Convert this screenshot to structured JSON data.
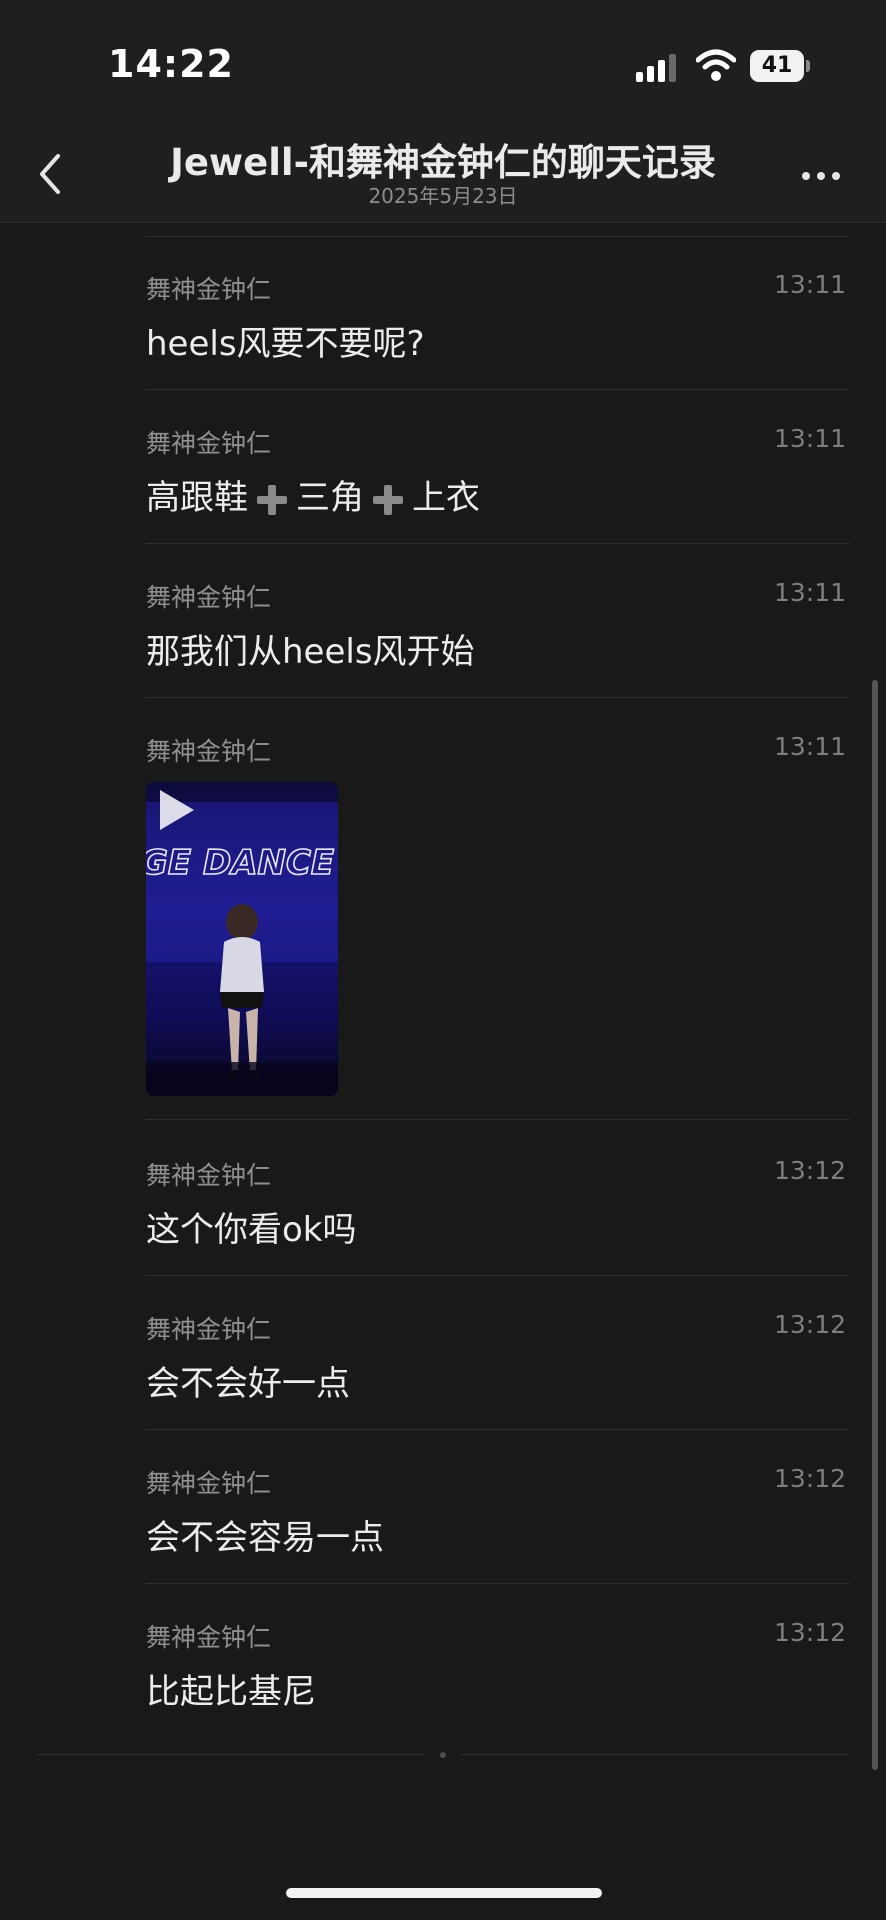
{
  "status_bar": {
    "time": "14:22",
    "battery_level": "41",
    "signal_icon": "cellular-signal-icon",
    "wifi_icon": "wifi-icon"
  },
  "nav": {
    "title": "Jewell-和舞神金钟仁的聊天记录",
    "subtitle": "2025年5月23日",
    "back_icon": "chevron-left-icon",
    "more_icon": "more-horizontal-icon"
  },
  "messages": [
    {
      "sender": "舞神金钟仁",
      "time": "13:11",
      "text": "heels风要不要呢?"
    },
    {
      "sender": "舞神金钟仁",
      "time": "13:11",
      "parts": [
        "高跟鞋",
        "三角",
        "上衣"
      ]
    },
    {
      "sender": "舞神金钟仁",
      "time": "13:11",
      "text": "那我们从heels风开始"
    },
    {
      "sender": "舞神金钟仁",
      "time": "13:11",
      "video_caption": "GE DANCE"
    },
    {
      "sender": "舞神金钟仁",
      "time": "13:12",
      "text": "这个你看ok吗"
    },
    {
      "sender": "舞神金钟仁",
      "time": "13:12",
      "text": "会不会好一点"
    },
    {
      "sender": "舞神金钟仁",
      "time": "13:12",
      "text": "会不会容易一点"
    },
    {
      "sender": "舞神金钟仁",
      "time": "13:12",
      "text": "比起比基尼"
    }
  ],
  "colors": {
    "background": "#191919",
    "bar": "#1f1f1f",
    "text_primary": "#ececec",
    "text_secondary": "#8f8f8f"
  }
}
